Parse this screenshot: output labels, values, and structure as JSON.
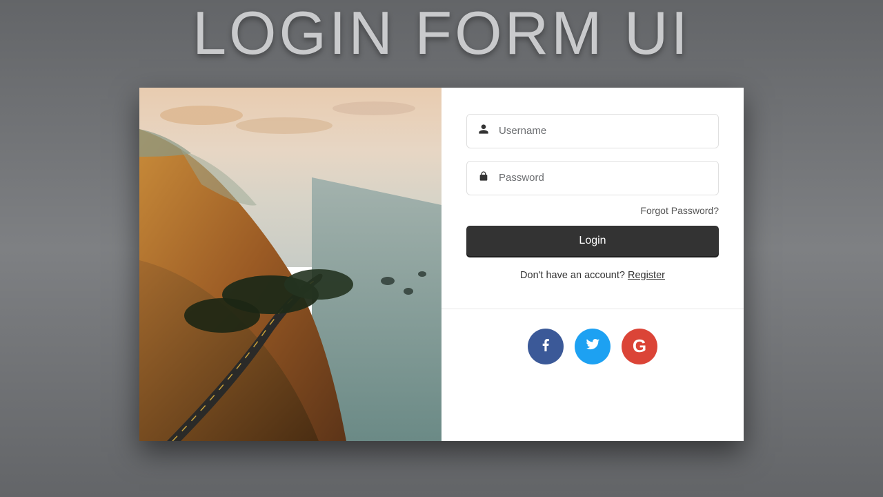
{
  "page_title": "LOGIN FORM UI",
  "form": {
    "username_placeholder": "Username",
    "password_placeholder": "Password",
    "forgot_label": "Forgot Password?",
    "login_label": "Login",
    "register_prompt": "Don't have an account? ",
    "register_label": "Register"
  },
  "social": {
    "facebook": "facebook",
    "twitter": "twitter",
    "google": "google",
    "google_glyph": "G"
  },
  "colors": {
    "button_bg": "#333333",
    "facebook_bg": "#3b5998",
    "twitter_bg": "#1da1f2",
    "google_bg": "#db4437"
  }
}
